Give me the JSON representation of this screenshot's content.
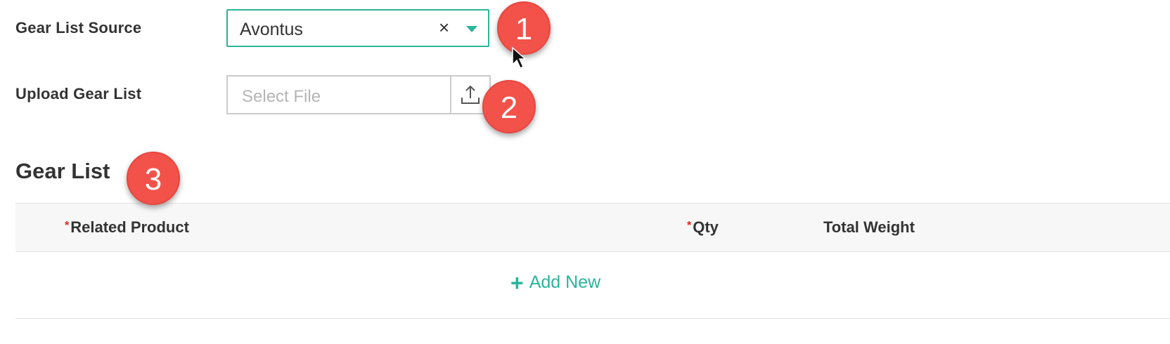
{
  "form": {
    "source_label": "Gear List Source",
    "source_value": "Avontus",
    "clear_glyph": "×",
    "upload_label": "Upload Gear List",
    "upload_placeholder": "Select File"
  },
  "gear_list": {
    "heading": "Gear List",
    "columns": [
      {
        "label": "Related Product",
        "required": true
      },
      {
        "label": "Qty",
        "required": true
      },
      {
        "label": "Total Weight",
        "required": false
      }
    ],
    "required_mark": "*",
    "add_new_label": "Add New",
    "add_new_icon": "plus-icon"
  },
  "annotations": {
    "badge_1": "1",
    "badge_2": "2",
    "badge_3": "3"
  },
  "colors": {
    "accent": "#2bb59a",
    "badge": "#f2524a",
    "required": "#e2211c"
  }
}
